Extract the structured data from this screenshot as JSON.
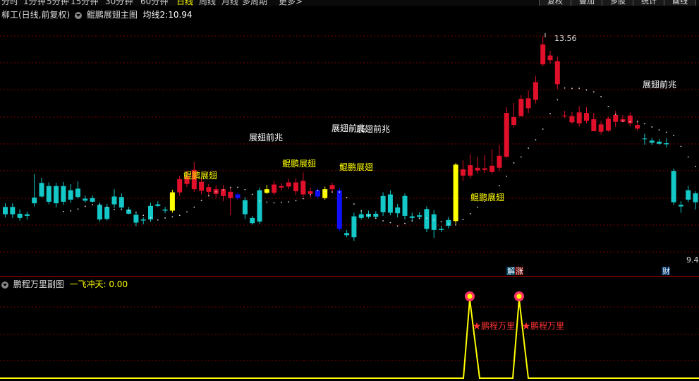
{
  "toolbar": {
    "periods": [
      "分时",
      "1分钟",
      "5分钟",
      "15分钟",
      "30分钟",
      "60分钟",
      "日线",
      "周线",
      "月线",
      "多周期",
      "更多>"
    ],
    "active_period": "日线",
    "buttons": [
      "复权",
      "叠加",
      "多股",
      "统计",
      "画线"
    ]
  },
  "main_chart": {
    "stock_name": "柳工(日线,前复权)",
    "indicator_name": "鲲鹏展翅主图",
    "ma_label": "均线2:",
    "ma_value": "10.94",
    "high_label": "13.56",
    "low_label": "9.4",
    "signal_labels": {
      "kunpeng": "鲲鹏展翅",
      "qianzhao": "展翅前兆"
    },
    "event_markers": [
      "解",
      "涨",
      "财"
    ]
  },
  "sub_chart": {
    "indicator_name": "鹏程万里副图",
    "line_label": "一飞冲天:",
    "line_value": "0.00",
    "signal_label": "鹏程万里"
  },
  "colors": {
    "up": "#e0102a",
    "down": "#14c8c8",
    "signal_yellow": "#ffff00",
    "signal_blue": "#1010ff",
    "grid": "#7a0000"
  },
  "chart_data": {
    "type": "candlestick",
    "candles": [
      [
        10.12,
        10.26,
        10.33,
        10.06,
        "d"
      ],
      [
        10.26,
        10.12,
        10.33,
        10.05,
        "d"
      ],
      [
        10.13,
        10.05,
        10.21,
        10.0,
        "d"
      ],
      [
        10.09,
        10.12,
        10.17,
        10.02,
        "d"
      ],
      [
        10.44,
        10.33,
        10.89,
        10.27,
        "d"
      ],
      [
        10.72,
        10.46,
        10.82,
        10.44,
        "d"
      ],
      [
        10.66,
        10.36,
        10.73,
        10.31,
        "d"
      ],
      [
        10.66,
        10.33,
        10.72,
        10.25,
        "d"
      ],
      [
        10.66,
        10.36,
        10.74,
        10.3,
        "d"
      ],
      [
        10.58,
        10.4,
        10.7,
        10.34,
        "d"
      ],
      [
        10.61,
        10.45,
        10.75,
        10.42,
        "d"
      ],
      [
        10.42,
        10.38,
        10.48,
        10.34,
        "d"
      ],
      [
        10.43,
        10.36,
        10.48,
        10.34,
        "d"
      ],
      [
        10.3,
        10.02,
        10.35,
        9.98,
        "d"
      ],
      [
        10.26,
        10.03,
        10.32,
        10.0,
        "d"
      ],
      [
        10.46,
        10.31,
        10.6,
        10.24,
        "d"
      ],
      [
        10.45,
        10.25,
        10.52,
        10.21,
        "d"
      ],
      [
        10.21,
        10.13,
        10.26,
        10.12,
        "d"
      ],
      [
        10.11,
        9.96,
        10.15,
        9.89,
        "d"
      ],
      [
        10.0,
        10.02,
        10.06,
        9.93,
        "d"
      ],
      [
        10.28,
        10.02,
        10.34,
        9.98,
        "d"
      ],
      [
        10.28,
        10.31,
        10.37,
        10.26,
        "d"
      ],
      [
        10.19,
        10.21,
        10.26,
        10.14,
        "d"
      ],
      [
        10.19,
        10.54,
        10.59,
        10.15,
        "y"
      ],
      [
        10.54,
        10.79,
        10.86,
        10.47,
        "u"
      ],
      [
        10.7,
        10.85,
        10.95,
        10.64,
        "u"
      ],
      [
        10.6,
        10.97,
        11.12,
        10.55,
        "u"
      ],
      [
        10.57,
        10.74,
        10.82,
        10.5,
        "u"
      ],
      [
        10.55,
        10.64,
        10.7,
        10.48,
        "u"
      ],
      [
        10.51,
        10.6,
        10.67,
        10.44,
        "u"
      ],
      [
        10.47,
        10.6,
        10.68,
        10.37,
        "u"
      ],
      [
        10.43,
        10.55,
        10.62,
        10.1,
        "u"
      ],
      [
        10.5,
        10.43,
        10.53,
        10.4,
        "b"
      ],
      [
        10.39,
        10.12,
        10.45,
        10.03,
        "d"
      ],
      [
        10.05,
        9.95,
        10.09,
        9.92,
        "d"
      ],
      [
        9.98,
        10.58,
        10.63,
        9.93,
        "d"
      ],
      [
        10.6,
        10.53,
        10.68,
        10.51,
        "y"
      ],
      [
        10.53,
        10.69,
        10.76,
        10.49,
        "u"
      ],
      [
        10.63,
        10.66,
        10.72,
        10.57,
        "u"
      ],
      [
        10.65,
        10.73,
        10.8,
        10.6,
        "u"
      ],
      [
        10.56,
        10.73,
        10.81,
        10.49,
        "u"
      ],
      [
        10.5,
        10.76,
        10.92,
        10.45,
        "u"
      ],
      [
        10.51,
        10.56,
        10.63,
        10.44,
        "u"
      ],
      [
        10.58,
        10.46,
        10.62,
        10.42,
        "b"
      ],
      [
        10.6,
        10.43,
        10.65,
        10.4,
        "y"
      ],
      [
        10.6,
        10.68,
        10.72,
        10.53,
        "u"
      ],
      [
        10.58,
        9.84,
        10.63,
        9.8,
        "b"
      ],
      [
        9.76,
        9.72,
        9.82,
        9.68,
        "d"
      ],
      [
        10.08,
        9.68,
        10.15,
        9.61,
        "d"
      ],
      [
        10.12,
        10.05,
        10.2,
        10.02,
        "d"
      ],
      [
        10.07,
        10.13,
        10.19,
        10.04,
        "d"
      ],
      [
        10.13,
        10.07,
        10.18,
        10.05,
        "d"
      ],
      [
        10.47,
        10.16,
        10.54,
        10.09,
        "d"
      ],
      [
        10.5,
        10.15,
        10.58,
        10.1,
        "d"
      ],
      [
        10.14,
        10.25,
        10.32,
        10.06,
        "d"
      ],
      [
        10.47,
        10.09,
        10.52,
        10.02,
        "d"
      ],
      [
        10.08,
        10.05,
        10.15,
        10.0,
        "d"
      ],
      [
        10.07,
        10.1,
        10.16,
        10.03,
        "d"
      ],
      [
        10.22,
        9.84,
        10.27,
        9.78,
        "d"
      ],
      [
        10.12,
        9.82,
        10.2,
        9.67,
        "d"
      ],
      [
        9.84,
        9.82,
        9.9,
        9.78,
        "d"
      ],
      [
        9.9,
        10.01,
        10.07,
        9.85,
        "d"
      ],
      [
        9.99,
        11.07,
        11.1,
        9.94,
        "y"
      ],
      [
        10.86,
        10.98,
        11.15,
        10.76,
        "u"
      ],
      [
        10.86,
        11.06,
        11.27,
        10.81,
        "u"
      ],
      [
        10.96,
        11.01,
        11.22,
        10.9,
        "u"
      ],
      [
        10.97,
        11.0,
        11.25,
        10.91,
        "u"
      ],
      [
        10.93,
        11.05,
        11.37,
        10.89,
        "u"
      ],
      [
        11.01,
        11.24,
        11.44,
        10.95,
        "u"
      ],
      [
        11.22,
        12.06,
        12.17,
        11.2,
        "u"
      ],
      [
        11.83,
        11.98,
        12.25,
        11.78,
        "u"
      ],
      [
        12.0,
        12.33,
        12.4,
        11.99,
        "u"
      ],
      [
        12.15,
        12.34,
        12.49,
        12.06,
        "u"
      ],
      [
        12.31,
        12.65,
        12.77,
        12.24,
        "u"
      ],
      [
        12.99,
        13.37,
        13.53,
        12.95,
        "u"
      ],
      [
        13.07,
        13.16,
        13.25,
        13.0,
        "u"
      ],
      [
        12.61,
        13.05,
        13.14,
        12.52,
        "u"
      ],
      [
        12.01,
        12.0,
        12.1,
        11.96,
        "u"
      ],
      [
        11.88,
        12.0,
        12.08,
        11.85,
        "u"
      ],
      [
        11.86,
        12.07,
        12.19,
        11.8,
        "u"
      ],
      [
        11.91,
        12.06,
        12.17,
        11.86,
        "u"
      ],
      [
        11.71,
        11.94,
        12.06,
        11.71,
        "u"
      ],
      [
        11.7,
        11.84,
        11.9,
        11.65,
        "u"
      ],
      [
        11.72,
        11.95,
        11.99,
        11.7,
        "u"
      ],
      [
        11.89,
        12.02,
        12.1,
        11.79,
        "u"
      ],
      [
        11.94,
        11.89,
        12.02,
        11.88,
        "u"
      ],
      [
        11.86,
        12.01,
        12.07,
        11.8,
        "u"
      ],
      [
        11.83,
        11.76,
        11.92,
        11.72,
        "u"
      ],
      [
        11.56,
        11.57,
        11.66,
        11.45,
        "d"
      ],
      [
        11.53,
        11.49,
        11.58,
        11.45,
        "d"
      ],
      [
        11.51,
        11.47,
        11.56,
        11.45,
        "d"
      ],
      [
        11.48,
        11.46,
        11.58,
        11.4,
        "d"
      ],
      [
        10.95,
        10.35,
        11.0,
        10.3,
        "d"
      ],
      [
        10.3,
        10.27,
        10.37,
        10.15,
        "d"
      ],
      [
        10.4,
        10.58,
        10.66,
        10.35,
        "d"
      ],
      [
        10.35,
        10.52,
        10.56,
        10.21,
        "d"
      ],
      [
        10.41,
        10.37,
        10.5,
        10.33,
        "d"
      ]
    ],
    "y_high": "13.56",
    "y_low": "9.4",
    "sub_series": {
      "name": "一飞冲天",
      "signals_at": [
        66,
        73
      ],
      "value": "0.00"
    }
  }
}
